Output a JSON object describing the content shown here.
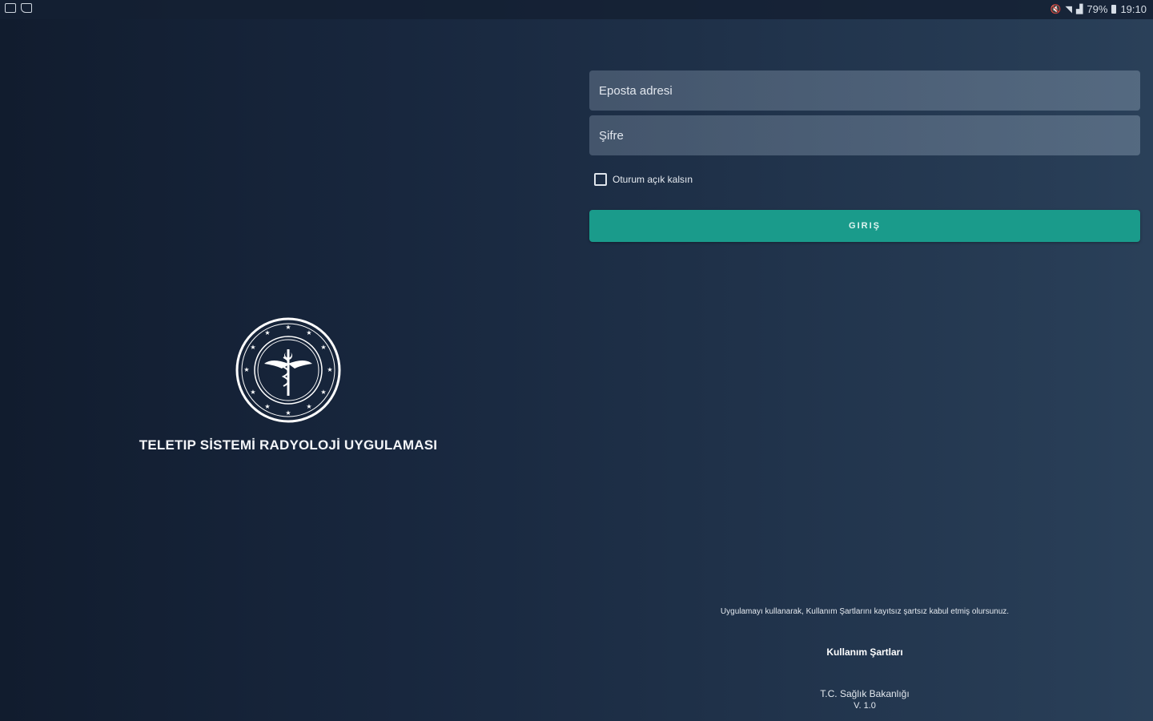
{
  "status_bar": {
    "left_icons": [
      "image-icon",
      "cast-icon"
    ],
    "battery": "79%",
    "time": "19:10"
  },
  "brand": {
    "title": "TELETIP SİSTEMİ RADYOLOJİ UYGULAMASI"
  },
  "login": {
    "email_placeholder": "Eposta adresi",
    "email_value": "",
    "password_placeholder": "Şifre",
    "password_value": "",
    "remember_label": "Oturum açık kalsın",
    "remember_checked": false,
    "submit_label": "GIRIŞ"
  },
  "footer": {
    "terms_note": "Uygulamayı kullanarak, Kullanım Şartlarını kayıtsız şartsız kabul etmiş olursunuz.",
    "terms_link": "Kullanım Şartları",
    "ministry": "T.C. Sağlık Bakanlığı",
    "version": "V. 1.0"
  },
  "colors": {
    "accent": "#1a9b8b",
    "background_dark": "#111c2e",
    "background_light": "#2a4059"
  }
}
